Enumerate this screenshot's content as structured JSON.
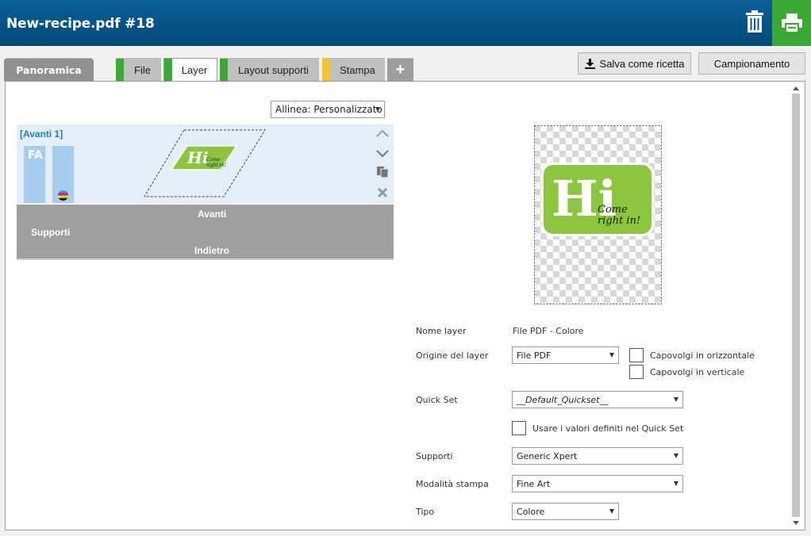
{
  "window": {
    "title": "New-recipe.pdf #18"
  },
  "tabs": [
    {
      "label": "Panoramica"
    },
    {
      "label": "File",
      "color": "#3aaa35"
    },
    {
      "label": "Layer",
      "color": "#3aaa35"
    },
    {
      "label": "Layout supporti",
      "color": "#3aaa35"
    },
    {
      "label": "Stampa",
      "color": "#f5c430"
    },
    {
      "label": "+"
    }
  ],
  "toolbar": {
    "save_recipe": "Salva come ricetta",
    "sampling": "Campionamento"
  },
  "align": {
    "value": "Allinea: Personalizzato"
  },
  "layers": {
    "front_title": "[Avanti 1]",
    "fa_label": "FA",
    "media": {
      "front": "Avanti",
      "media_label": "Supporti",
      "back": "Indietro"
    }
  },
  "preview": {
    "logo_text": "Hi",
    "logo_tagline_1": "Come",
    "logo_tagline_2": "right in!",
    "accent": "#8cc63f"
  },
  "form": {
    "layer_name_label": "Nome layer",
    "layer_name_value": "File PDF - Colore",
    "origin_label": "Origine del layer",
    "origin_value": "File PDF",
    "flip_h": "Capovolgi in orizzontale",
    "flip_v": "Capovolgi in verticale",
    "quickset_label": "Quick Set",
    "quickset_value": "__Default_Quickset__",
    "use_quickset": "Usare i valori definiti nel Quick Set",
    "media_label": "Supporti",
    "media_value": "Generic Xpert",
    "mode_label": "Modalità stampa",
    "mode_value": "Fine Art",
    "type_label": "Tipo",
    "type_value": "Colore"
  }
}
